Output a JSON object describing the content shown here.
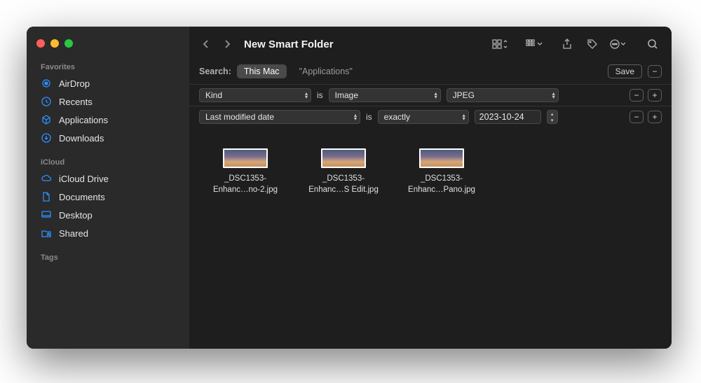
{
  "window": {
    "title": "New Smart Folder"
  },
  "sidebar": {
    "sections": [
      {
        "title": "Favorites",
        "items": [
          {
            "label": "AirDrop",
            "icon": "airdrop-icon"
          },
          {
            "label": "Recents",
            "icon": "clock-icon"
          },
          {
            "label": "Applications",
            "icon": "apps-icon"
          },
          {
            "label": "Downloads",
            "icon": "download-icon"
          }
        ]
      },
      {
        "title": "iCloud",
        "items": [
          {
            "label": "iCloud Drive",
            "icon": "cloud-icon"
          },
          {
            "label": "Documents",
            "icon": "doc-icon"
          },
          {
            "label": "Desktop",
            "icon": "desktop-icon"
          },
          {
            "label": "Shared",
            "icon": "shared-icon"
          }
        ]
      },
      {
        "title": "Tags",
        "items": []
      }
    ]
  },
  "search": {
    "label": "Search:",
    "scope_active": "This Mac",
    "scope_inactive": "\"Applications\"",
    "save_label": "Save"
  },
  "criteria": [
    {
      "attr": "Kind",
      "op": "is",
      "val1": "Image",
      "val2": "JPEG"
    },
    {
      "attr": "Last modified date",
      "op": "is",
      "val1": "exactly",
      "date": "2023-10-24"
    }
  ],
  "results": [
    {
      "line1": "_DSC1353-",
      "line2": "Enhanc…no-2.jpg"
    },
    {
      "line1": "_DSC1353-",
      "line2": "Enhanc…S Edit.jpg"
    },
    {
      "line1": "_DSC1353-",
      "line2": "Enhanc…Pano.jpg"
    }
  ]
}
